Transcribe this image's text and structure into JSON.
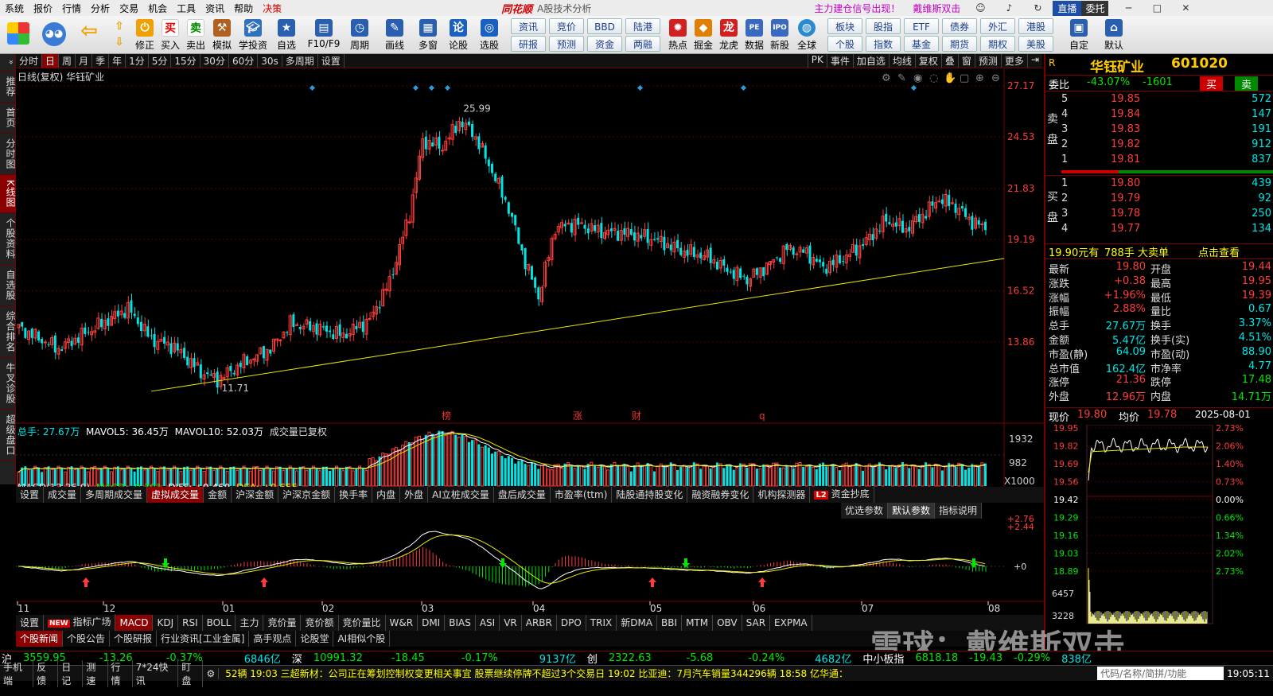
{
  "menu": {
    "items": [
      "系统",
      "报价",
      "行情",
      "分析",
      "交易",
      "机会",
      "工具",
      "资讯",
      "帮助",
      "决策"
    ],
    "logo": "同花顺",
    "subtitle": "A股技术分析",
    "promo1": "主力建仓信号出现！",
    "promo2": "戴维斯双击",
    "live": "直播",
    "wt": "委托"
  },
  "toolbar": {
    "buttons": [
      "修正",
      "买入",
      "卖出",
      "模拟",
      "学投资",
      "自选",
      "F10/F9",
      "周期",
      "画线",
      "多窗",
      "论股",
      "选股",
      "热点",
      "掘金",
      "龙虎",
      "数据",
      "新股",
      "全球",
      "自定",
      "默认"
    ],
    "quick_row1": [
      "资讯",
      "竞价",
      "BBD",
      "陆港",
      "板块",
      "股指",
      "ETF",
      "债券",
      "外汇",
      "港股"
    ],
    "quick_row2": [
      "研报",
      "预测",
      "资金",
      "两融",
      "个股",
      "指数",
      "基金",
      "期货",
      "期权",
      "美股"
    ]
  },
  "leftnav": [
    "推荐",
    "首页",
    "分时图",
    "K线图",
    "个股资料",
    "自选股",
    "综合排名",
    "牛叉诊股",
    "超级盘口"
  ],
  "period_tabs": [
    "分时",
    "日",
    "周",
    "月",
    "季",
    "年",
    "1分",
    "5分",
    "15分",
    "30分",
    "60分",
    "30s",
    "多周期",
    "设置"
  ],
  "period_active": "日",
  "right_tabs": [
    "PK",
    "事件",
    "加自选",
    "均线",
    "复权",
    "叠",
    "窗",
    "预测",
    "更多"
  ],
  "kline": {
    "caption": "日线(复权) 华钰矿业",
    "high_label": "25.99",
    "low_label": "11.71",
    "price_ticks": [
      "27.17",
      "24.53",
      "21.83",
      "19.19",
      "16.52",
      "13.86"
    ],
    "event_marks": [
      "榜",
      "涨",
      "财",
      "q"
    ]
  },
  "volume": {
    "legend_total": "总手: 27.67万",
    "legend_ma5": "MAVOL5: 36.45万",
    "legend_ma10": "MAVOL10: 52.03万",
    "legend_note": "成交量已复权",
    "ticks": [
      "1932",
      "982"
    ],
    "unit": "X1000"
  },
  "ind_tabs1": [
    "设置",
    "成交量",
    "多周期成交量",
    "虚拟成交量",
    "金额",
    "沪深金额",
    "沪深京金额",
    "换手率",
    "内盘",
    "外盘",
    "AI立桩成交量",
    "盘后成交量",
    "市盈率(ttm)",
    "陆股通持股变化",
    "融资融券变化",
    "机构探测器",
    "资金抄底"
  ],
  "ind_tabs1_active": "虚拟成交量",
  "ind_opts": [
    "优选参数",
    "默认参数",
    "指标说明"
  ],
  "macd": {
    "name": "MACD(12,26,9)",
    "macd": "MACD: -0.391",
    "diff": "DIFF: +0.460",
    "dea": "DEA: +0.655",
    "ticks": [
      "+2.76",
      "+2.44",
      "+0"
    ]
  },
  "x_labels": [
    "11",
    "12",
    "01",
    "02",
    "03",
    "04",
    "05",
    "06",
    "07",
    "08"
  ],
  "ind_tabs2": [
    "设置",
    "指标广场",
    "MACD",
    "KDJ",
    "RSI",
    "BOLL",
    "主力",
    "竞价量",
    "竞价额",
    "竞价量比",
    "W&R",
    "DMI",
    "BIAS",
    "ASI",
    "VR",
    "ARBR",
    "DPO",
    "TRIX",
    "新DMA",
    "BBI",
    "MTM",
    "OBV",
    "SAR",
    "EXPMA"
  ],
  "ind_tabs2_active": "MACD",
  "ind_tabs2_new": "NEW",
  "news_tabs": [
    "个股新闻",
    "个股公告",
    "个股研报",
    "行业资讯[工业金属]",
    "高手观点",
    "论股堂",
    "AI相似个股"
  ],
  "stock": {
    "name": "华钰矿业",
    "code": "601020",
    "weibi_label": "委比",
    "weibi": "-43.07%",
    "weicha": "-1601",
    "buy_btn": "买",
    "sell_btn": "卖",
    "sell_label": "卖盘",
    "buy_label": "买盘",
    "asks": [
      {
        "n": "5",
        "p": "19.85",
        "v": "572"
      },
      {
        "n": "4",
        "p": "19.84",
        "v": "147"
      },
      {
        "n": "3",
        "p": "19.83",
        "v": "191"
      },
      {
        "n": "2",
        "p": "19.82",
        "v": "912"
      },
      {
        "n": "1",
        "p": "19.81",
        "v": "837"
      }
    ],
    "bids": [
      {
        "n": "1",
        "p": "19.80",
        "v": "439"
      },
      {
        "n": "2",
        "p": "19.79",
        "v": "92"
      },
      {
        "n": "3",
        "p": "19.78",
        "v": "250"
      },
      {
        "n": "4",
        "p": "19.77",
        "v": "134"
      }
    ],
    "big_line": {
      "a": "19.90元有",
      "b": "788手",
      "c": "大卖单",
      "d": "点击查看"
    },
    "stats": [
      [
        "最新",
        "19.80",
        "开盘",
        "19.44"
      ],
      [
        "涨跌",
        "+0.38",
        "最高",
        "19.95"
      ],
      [
        "涨幅",
        "+1.96%",
        "最低",
        "19.39"
      ],
      [
        "振幅",
        "2.88%",
        "量比",
        "0.67"
      ],
      [
        "总手",
        "27.67万",
        "换手",
        "3.37%"
      ],
      [
        "金额",
        "5.47亿",
        "换手(实)",
        "4.51%"
      ],
      [
        "市盈(静)",
        "64.09",
        "市盈(动)",
        "88.90"
      ],
      [
        "总市值",
        "162.4亿",
        "市净率",
        "4.77"
      ],
      [
        "涨停",
        "21.36",
        "跌停",
        "17.48"
      ],
      [
        "外盘",
        "12.96万",
        "内盘",
        "14.71万"
      ]
    ],
    "mini": {
      "now_label": "现价",
      "now": "19.80",
      "avg_label": "均价",
      "avg": "19.78",
      "date": "2025-08-01",
      "left_ticks": [
        "19.95",
        "19.82",
        "19.69",
        "19.56",
        "19.42",
        "19.29",
        "19.16",
        "19.03",
        "18.89"
      ],
      "right_ticks": [
        "2.73%",
        "2.06%",
        "1.40%",
        "0.73%",
        "0.00%",
        "0.66%",
        "1.34%",
        "2.02%",
        "2.73%"
      ],
      "vol_ticks": [
        "6457",
        "3228"
      ]
    }
  },
  "status": {
    "sh": [
      "沪",
      "3559.95",
      "-13.26",
      "-0.37%",
      "6846亿"
    ],
    "sz": [
      "深",
      "10991.32",
      "-18.45",
      "-0.17%",
      "9137亿"
    ],
    "cy": [
      "创",
      "2322.63",
      "-5.68",
      "-0.24%",
      "4682亿"
    ],
    "zx": [
      "中小板指",
      "6818.18",
      "-19.43",
      "-0.29%",
      "838亿"
    ]
  },
  "newsbar": {
    "tabs": [
      "手机端",
      "反馈",
      "日记",
      "测速",
      "行情",
      "7*24快讯",
      "盯盘"
    ],
    "ticker": "52辆   19:03 三超新材：公司正在筹划控制权变更相关事宜 股票继续停牌不超过3个交易日     19:02 比亚迪：7月汽车销量344296辆     18:58 亿华通：",
    "search": "代码/名称/简拼/功能",
    "time": "19:05:11"
  },
  "watermark": "雪球：戴维斯双击"
}
